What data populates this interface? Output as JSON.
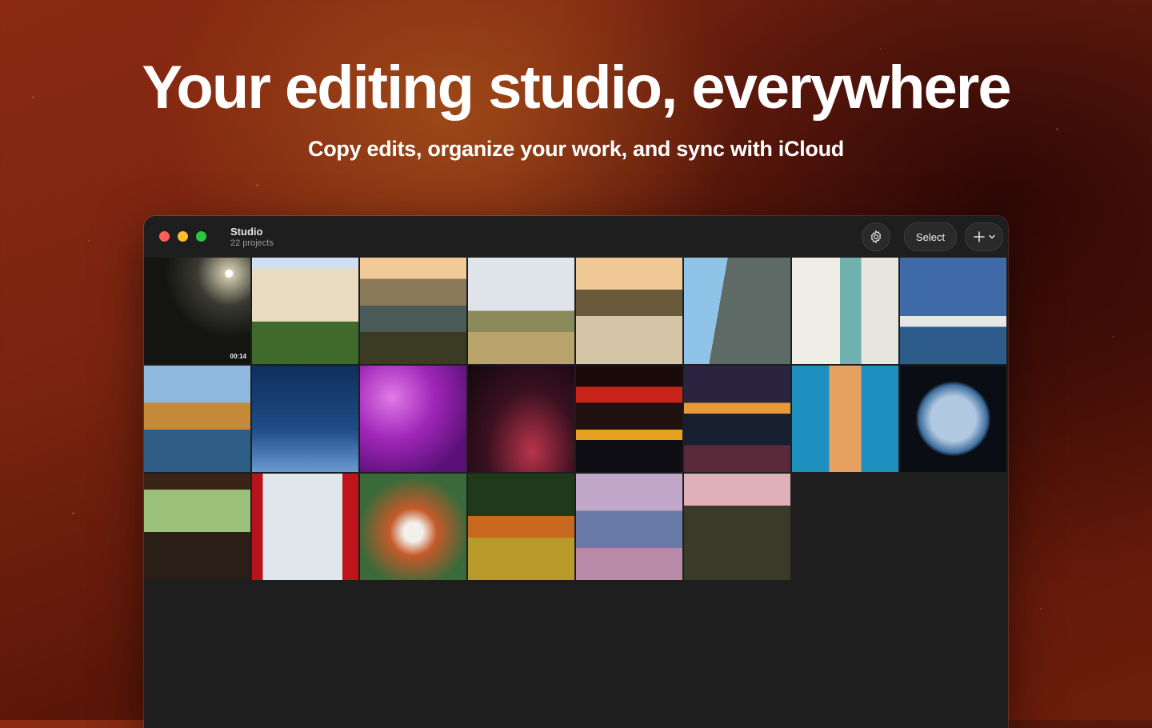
{
  "hero": {
    "title": "Your editing studio, everywhere",
    "subtitle": "Copy edits, organize your work, and sync with iCloud"
  },
  "window": {
    "title": "Studio",
    "subtitle": "22 projects",
    "select_label": "Select",
    "icons": {
      "settings": "gear-icon",
      "add": "plus-icon",
      "menu": "chevron-down-icon"
    }
  },
  "colors": {
    "close": "#fe5f57",
    "minimize": "#febc2e",
    "zoom": "#28c840",
    "window_bg": "#1e1e1e"
  },
  "tiles": [
    {
      "name": "tile-night-snow-streetlight",
      "duration": "00:14"
    },
    {
      "name": "tile-balcony-building"
    },
    {
      "name": "tile-sea-cliffs-sunset"
    },
    {
      "name": "tile-coastal-path"
    },
    {
      "name": "tile-rocky-shore-dusk"
    },
    {
      "name": "tile-cliff-blue-sea"
    },
    {
      "name": "tile-white-door-flowers"
    },
    {
      "name": "tile-cruise-ship"
    },
    {
      "name": "tile-golden-cliff-sea"
    },
    {
      "name": "tile-deep-blue-water"
    },
    {
      "name": "tile-purple-flowers"
    },
    {
      "name": "tile-silhouette-city-lights"
    },
    {
      "name": "tile-neon-signs-street"
    },
    {
      "name": "tile-night-street-rain"
    },
    {
      "name": "tile-lighthouse"
    },
    {
      "name": "tile-airplane-window"
    },
    {
      "name": "tile-room-piano-window"
    },
    {
      "name": "tile-red-curtain-window"
    },
    {
      "name": "tile-red-panda"
    },
    {
      "name": "tile-deer-grass"
    },
    {
      "name": "tile-woman-beach"
    },
    {
      "name": "tile-woman-field-dusk"
    }
  ]
}
